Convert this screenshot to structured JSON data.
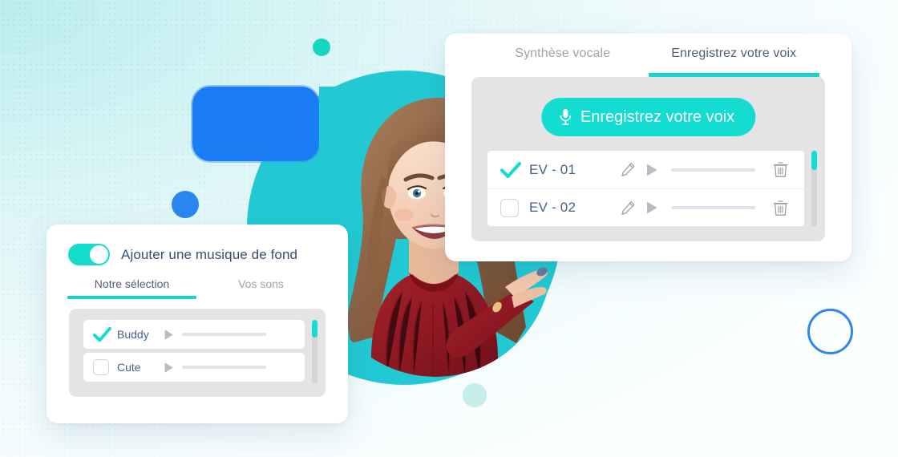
{
  "background": {
    "gradient_from": "#bdeef0",
    "gradient_to": "#fbfeff",
    "shapes": [
      {
        "name": "teal-blob",
        "color": "#22c9d3"
      },
      {
        "name": "blue-rounded-rect",
        "color": "#1b7df4"
      },
      {
        "name": "blue-dot",
        "color": "#2a86f0"
      },
      {
        "name": "teal-dot",
        "color": "#16d6be"
      },
      {
        "name": "mint-dot",
        "color": "#c5eeea"
      },
      {
        "name": "blue-ring-outline",
        "color": "#2f86ec"
      }
    ]
  },
  "accent": {
    "teal": "#13dcd0",
    "tab_underline": "#16d5cd",
    "label_blue": "#46618e",
    "muted": "#9aa4ad"
  },
  "photo": {
    "alt": "Smiling young woman in red knit sweater pointing to the right"
  },
  "voice_card": {
    "tabs": [
      {
        "label": "Synthèse vocale",
        "active": false
      },
      {
        "label": "Enregistrez votre voix",
        "active": true
      }
    ],
    "record_button": {
      "label": "Enregistrez votre voix",
      "icon": "microphone-icon"
    },
    "rows": [
      {
        "label": "EV - 01",
        "checked": true,
        "icons": [
          "pencil-icon",
          "play-icon",
          "progress-track",
          "trash-icon"
        ]
      },
      {
        "label": "EV - 02",
        "checked": false,
        "icons": [
          "pencil-icon",
          "play-icon",
          "progress-track",
          "trash-icon"
        ]
      }
    ],
    "scrollbar": {
      "thumb_color": "#13dcd0",
      "position": "top"
    }
  },
  "music_card": {
    "toggle": {
      "label": "Ajouter une musique de fond",
      "on": true
    },
    "tabs": [
      {
        "label": "Notre sélection",
        "active": true
      },
      {
        "label": "Vos sons",
        "active": false
      }
    ],
    "rows": [
      {
        "label": "Buddy",
        "checked": true,
        "icons": [
          "play-icon",
          "progress-track"
        ]
      },
      {
        "label": "Cute",
        "checked": false,
        "icons": [
          "play-icon",
          "progress-track"
        ]
      }
    ],
    "scrollbar": {
      "thumb_color": "#13dcd0",
      "position": "top"
    }
  }
}
